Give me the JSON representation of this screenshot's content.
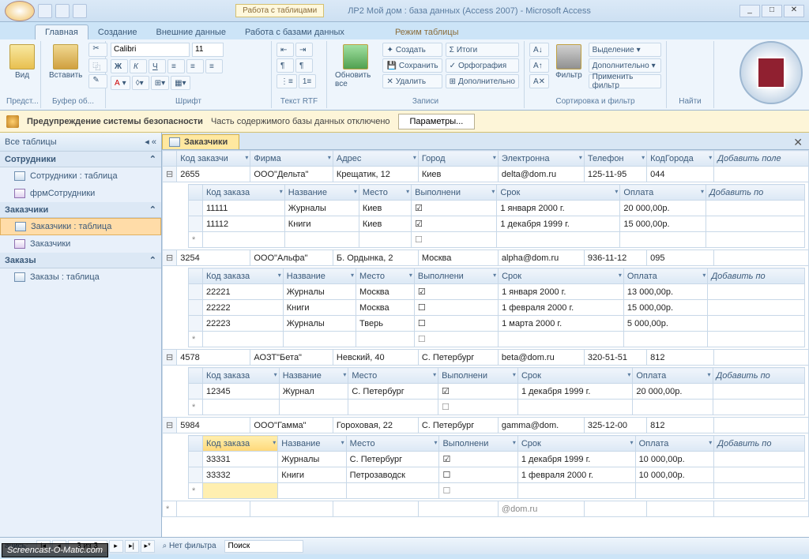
{
  "title_context": "Работа с таблицами",
  "app_title": "ЛР2 Мой дом : база данных (Access 2007) - Microsoft Access",
  "tabs": {
    "home": "Главная",
    "create": "Создание",
    "external": "Внешние данные",
    "dbtools": "Работа с базами данных",
    "datasheet": "Режим таблицы"
  },
  "ribbon": {
    "view": "Вид",
    "views_grp": "Предст...",
    "paste": "Вставить",
    "clipboard_grp": "Буфер об...",
    "font_name": "Calibri",
    "font_size": "11",
    "font_grp": "Шрифт",
    "rtf_grp": "Текст RTF",
    "refresh": "Обновить все",
    "new": "Создать",
    "save": "Сохранить",
    "delete": "Удалить",
    "totals": "Итоги",
    "spelling": "Орфография",
    "more": "Дополнительно",
    "records_grp": "Записи",
    "filter": "Фильтр",
    "selection": "Выделение",
    "advanced": "Дополнительно",
    "toggle": "Применить фильтр",
    "sortfilter_grp": "Сортировка и фильтр",
    "find_grp": "Найти"
  },
  "security": {
    "title": "Предупреждение системы безопасности",
    "msg": "Часть содержимого базы данных отключено",
    "params": "Параметры..."
  },
  "nav": {
    "header": "Все таблицы",
    "g1": "Сотрудники",
    "g1_items": [
      "Сотрудники : таблица",
      "фрмСотрудники"
    ],
    "g2": "Заказчики",
    "g2_items": [
      "Заказчики : таблица",
      "Заказчики"
    ],
    "g3": "Заказы",
    "g3_items": [
      "Заказы : таблица"
    ]
  },
  "doc_tab": "Заказчики",
  "main_cols": [
    "Код заказчи",
    "Фирма",
    "Адрес",
    "Город",
    "Электронна",
    "Телефон",
    "КодГорода"
  ],
  "add_field": "Добавить поле",
  "add_field_short": "Добавить по",
  "sub_cols": [
    "Код заказа",
    "Название",
    "Место",
    "Выполнени",
    "Срок",
    "Оплата"
  ],
  "customers": [
    {
      "code": "2655",
      "firm": "ООО\"Дельта\"",
      "addr": "Крещатик, 12",
      "city": "Киев",
      "email": "delta@dom.ru",
      "tel": "125-11-95",
      "ccode": "044",
      "orders": [
        {
          "oc": "11111",
          "name": "Журналы",
          "place": "Киев",
          "done": true,
          "due": "1 января 2000 г.",
          "pay": "20 000,00р."
        },
        {
          "oc": "11112",
          "name": "Книги",
          "place": "Киев",
          "done": true,
          "due": "1 декабря 1999 г.",
          "pay": "15 000,00р."
        }
      ]
    },
    {
      "code": "3254",
      "firm": "ООО\"Альфа\"",
      "addr": "Б. Ордынка, 2",
      "city": "Москва",
      "email": "alpha@dom.ru",
      "tel": "936-11-12",
      "ccode": "095",
      "orders": [
        {
          "oc": "22221",
          "name": "Журналы",
          "place": "Москва",
          "done": true,
          "due": "1 января 2000 г.",
          "pay": "13 000,00р."
        },
        {
          "oc": "22222",
          "name": "Книги",
          "place": "Москва",
          "done": false,
          "due": "1 февраля 2000 г.",
          "pay": "15 000,00р."
        },
        {
          "oc": "22223",
          "name": "Журналы",
          "place": "Тверь",
          "done": false,
          "due": "1 марта 2000 г.",
          "pay": "5 000,00р."
        }
      ]
    },
    {
      "code": "4578",
      "firm": "АОЗТ\"Бета\"",
      "addr": "Невский, 40",
      "city": "С. Петербург",
      "email": "beta@dom.ru",
      "tel": "320-51-51",
      "ccode": "812",
      "orders": [
        {
          "oc": "12345",
          "name": "Журнал",
          "place": "С. Петербург",
          "done": true,
          "due": "1 декабря 1999 г.",
          "pay": "20 000,00р."
        }
      ]
    },
    {
      "code": "5984",
      "firm": "ООО\"Гамма\"",
      "addr": "Гороховая, 22",
      "city": "С. Петербург",
      "email": "gamma@dom.",
      "tel": "325-12-00",
      "ccode": "812",
      "active": true,
      "orders": [
        {
          "oc": "33331",
          "name": "Журналы",
          "place": "С. Петербург",
          "done": true,
          "due": "1 декабря 1999 г.",
          "pay": "10 000,00р."
        },
        {
          "oc": "33332",
          "name": "Книги",
          "place": "Петрозаводск",
          "done": false,
          "due": "1 февраля 2000 г.",
          "pay": "10 000,00р."
        }
      ]
    }
  ],
  "new_email": "@dom.ru",
  "status": {
    "rec_label": "апись:",
    "rec_pos": "3 из 3",
    "nofilter": "Нет фильтра",
    "search": "Поиск"
  },
  "watermark": "Screencast-O-Matic.com"
}
